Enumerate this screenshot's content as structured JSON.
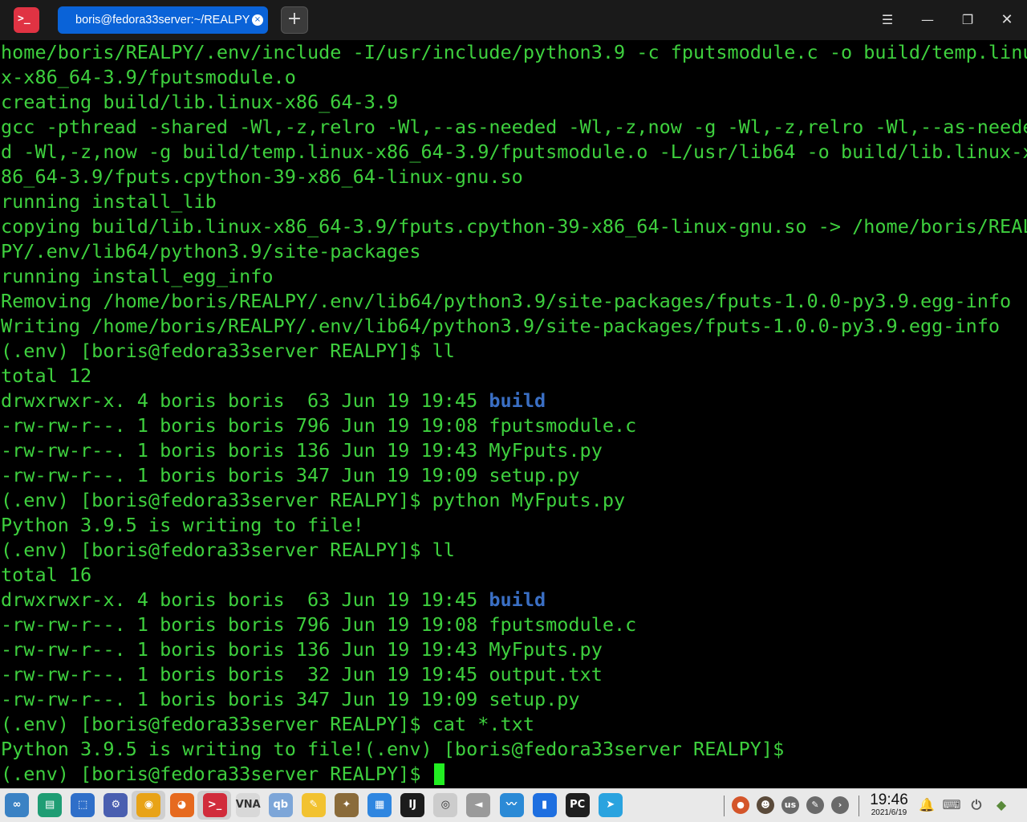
{
  "window": {
    "app_icon_glyph": ">_",
    "tab_title": "boris@fedora33server:~/REALPY",
    "tab_close_glyph": "×",
    "new_tab_glyph": "+",
    "menu_glyph": "☰",
    "minimize_glyph": "—",
    "maximize_glyph": "❐",
    "close_glyph": "✕"
  },
  "terminal": {
    "text_color": "#3ed03e",
    "dir_color": "#3a6fc4",
    "lines": [
      {
        "text": "home/boris/REALPY/.env/include -I/usr/include/python3.9 -c fputsmodule.c -o build/temp.linu"
      },
      {
        "text": "x-x86_64-3.9/fputsmodule.o"
      },
      {
        "text": "creating build/lib.linux-x86_64-3.9"
      },
      {
        "text": "gcc -pthread -shared -Wl,-z,relro -Wl,--as-needed -Wl,-z,now -g -Wl,-z,relro -Wl,--as-neede"
      },
      {
        "text": "d -Wl,-z,now -g build/temp.linux-x86_64-3.9/fputsmodule.o -L/usr/lib64 -o build/lib.linux-x"
      },
      {
        "text": "86_64-3.9/fputs.cpython-39-x86_64-linux-gnu.so"
      },
      {
        "text": "running install_lib"
      },
      {
        "text": "copying build/lib.linux-x86_64-3.9/fputs.cpython-39-x86_64-linux-gnu.so -> /home/boris/REAL"
      },
      {
        "text": "PY/.env/lib64/python3.9/site-packages"
      },
      {
        "text": "running install_egg_info"
      },
      {
        "text": "Removing /home/boris/REALPY/.env/lib64/python3.9/site-packages/fputs-1.0.0-py3.9.egg-info"
      },
      {
        "text": "Writing /home/boris/REALPY/.env/lib64/python3.9/site-packages/fputs-1.0.0-py3.9.egg-info"
      },
      {
        "text": "(.env) [boris@fedora33server REALPY]$ ll"
      },
      {
        "text": "total 12"
      },
      {
        "text": "drwxrwxr-x. 4 boris boris  63 Jun 19 19:45 ",
        "dir": "build"
      },
      {
        "text": "-rw-rw-r--. 1 boris boris 796 Jun 19 19:08 fputsmodule.c"
      },
      {
        "text": "-rw-rw-r--. 1 boris boris 136 Jun 19 19:43 MyFputs.py"
      },
      {
        "text": "-rw-rw-r--. 1 boris boris 347 Jun 19 19:09 setup.py"
      },
      {
        "text": "(.env) [boris@fedora33server REALPY]$ python MyFputs.py"
      },
      {
        "text": "Python 3.9.5 is writing to file!"
      },
      {
        "text": "(.env) [boris@fedora33server REALPY]$ ll"
      },
      {
        "text": "total 16"
      },
      {
        "text": "drwxrwxr-x. 4 boris boris  63 Jun 19 19:45 ",
        "dir": "build"
      },
      {
        "text": "-rw-rw-r--. 1 boris boris 796 Jun 19 19:08 fputsmodule.c"
      },
      {
        "text": "-rw-rw-r--. 1 boris boris 136 Jun 19 19:43 MyFputs.py"
      },
      {
        "text": "-rw-rw-r--. 1 boris boris  32 Jun 19 19:45 output.txt"
      },
      {
        "text": "-rw-rw-r--. 1 boris boris 347 Jun 19 19:09 setup.py"
      },
      {
        "text": "(.env) [boris@fedora33server REALPY]$ cat *.txt"
      },
      {
        "text": "Python 3.9.5 is writing to file!(.env) [boris@fedora33server REALPY]$"
      },
      {
        "text": "(.env) [boris@fedora33server REALPY]$ ",
        "cursor": true
      }
    ]
  },
  "taskbar": {
    "apps": [
      {
        "name": "launcher-icon",
        "glyph": "∞",
        "color": "#3b82c4"
      },
      {
        "name": "file-manager-icon",
        "glyph": "▤",
        "color": "#1f9d74"
      },
      {
        "name": "app-store-icon",
        "glyph": "⬚",
        "color": "#2f6fc9"
      },
      {
        "name": "settings-icon",
        "glyph": "⚙",
        "color": "#4a5fb0"
      },
      {
        "name": "chrome-icon",
        "glyph": "◉",
        "color": "#e8a317"
      },
      {
        "name": "firefox-icon",
        "glyph": "◕",
        "color": "#e66a1f"
      },
      {
        "name": "terminal-icon",
        "glyph": ">_",
        "color": "#d12c3b"
      },
      {
        "name": "vnc-viewer-icon",
        "glyph": "VNA",
        "color": "#d8d8d8"
      },
      {
        "name": "qbittorrent-icon",
        "glyph": "qb",
        "color": "#7da6d8"
      },
      {
        "name": "text-editor-icon",
        "glyph": "✎",
        "color": "#f2c230"
      },
      {
        "name": "game-icon",
        "glyph": "✦",
        "color": "#8a6b3a"
      },
      {
        "name": "app-grid-icon",
        "glyph": "▦",
        "color": "#2f86e0"
      },
      {
        "name": "intellij-icon",
        "glyph": "IJ",
        "color": "#1c1c1c"
      },
      {
        "name": "disc-icon",
        "glyph": "◎",
        "color": "#cccccc"
      },
      {
        "name": "audio-player-icon",
        "glyph": "◄",
        "color": "#9a9a9a"
      },
      {
        "name": "system-monitor-icon",
        "glyph": "〰",
        "color": "#2b8ad6"
      },
      {
        "name": "document-viewer-icon",
        "glyph": "▮",
        "color": "#1e6fe0"
      },
      {
        "name": "pycharm-icon",
        "glyph": "PC",
        "color": "#1f1f1f"
      },
      {
        "name": "telegram-icon",
        "glyph": "➤",
        "color": "#2aa3df"
      }
    ],
    "tray": [
      {
        "name": "tray-app-icon",
        "glyph": "●",
        "color": "#d4552a"
      },
      {
        "name": "tray-face-icon",
        "glyph": "☻",
        "color": "#5a4a3a"
      },
      {
        "name": "keyboard-layout-icon",
        "glyph": "us",
        "color": "#6a6a6a"
      },
      {
        "name": "tray-tool-icon",
        "glyph": "✎",
        "color": "#6a6a6a"
      },
      {
        "name": "tray-expand-icon",
        "glyph": "›",
        "color": "#6a6a6a"
      }
    ],
    "tray_right": [
      {
        "name": "notification-icon",
        "glyph": "🔔",
        "color": "#555"
      },
      {
        "name": "keyboard-icon",
        "glyph": "⌨",
        "color": "#555"
      },
      {
        "name": "power-icon",
        "glyph": "⏻",
        "color": "#555"
      },
      {
        "name": "shield-icon",
        "glyph": "◆",
        "color": "#5a8a3a"
      }
    ],
    "clock_time": "19:46",
    "clock_date": "2021/6/19"
  }
}
